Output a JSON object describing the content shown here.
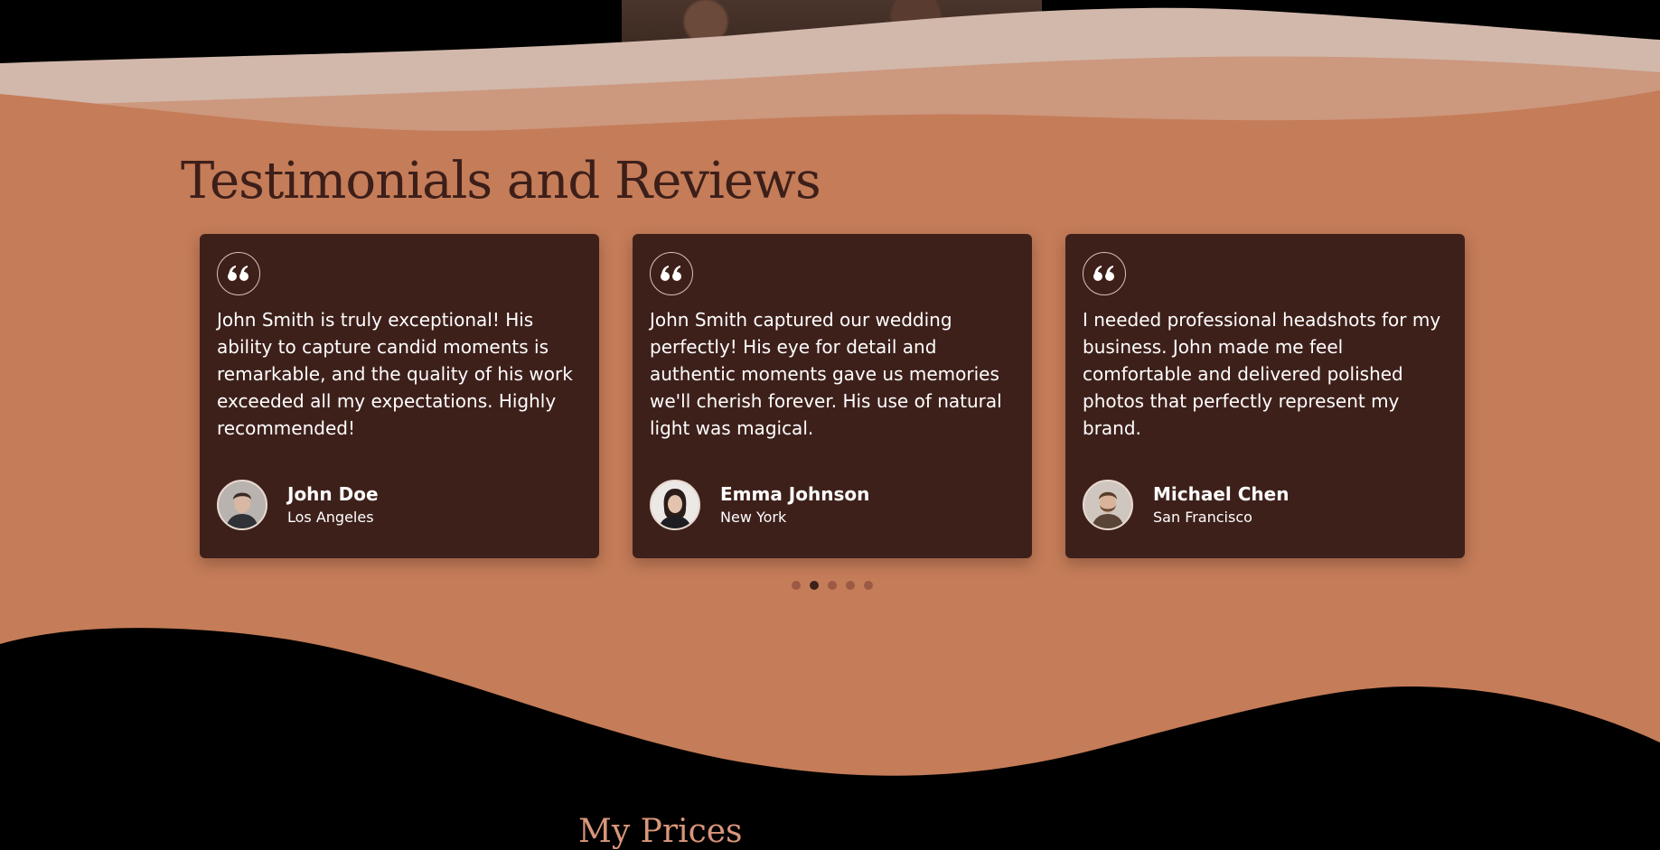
{
  "section": {
    "title": "Testimonials and Reviews"
  },
  "testimonials": [
    {
      "quote": "John Smith is truly exceptional! His ability to capture candid moments is remarkable, and the quality of his work exceeded all my expectations. Highly recommended!",
      "name": "John Doe",
      "city": "Los Angeles",
      "avatar_icon": "man-portrait"
    },
    {
      "quote": "John Smith captured our wedding perfectly! His eye for detail and authentic moments gave us memories we'll cherish forever. His use of natural light was magical.",
      "name": "Emma Johnson",
      "city": "New York",
      "avatar_icon": "woman-portrait"
    },
    {
      "quote": "I needed professional headshots for my business. John made me feel comfortable and delivered polished photos that perfectly represent my brand.",
      "name": "Michael Chen",
      "city": "San Francisco",
      "avatar_icon": "bearded-man-portrait"
    }
  ],
  "carousel": {
    "page_count": 5,
    "active_page": 2
  },
  "next_section": {
    "title": "My Prices"
  },
  "colors": {
    "background": "#000000",
    "section_bg": "#c57c58",
    "card_bg": "#3e201b",
    "title": "#3d1f1a",
    "wave_light": "#d2b8ab",
    "wave_mid": "#cc987e",
    "next_title": "#d8967a"
  }
}
